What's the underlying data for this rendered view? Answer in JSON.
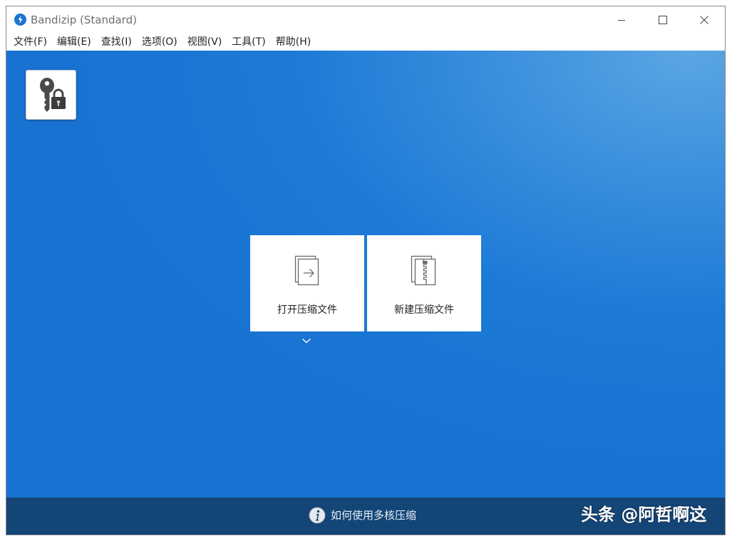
{
  "window": {
    "title": "Bandizip (Standard)"
  },
  "menu": [
    {
      "label": "文件(F)"
    },
    {
      "label": "编辑(E)"
    },
    {
      "label": "查找(I)"
    },
    {
      "label": "选项(O)"
    },
    {
      "label": "视图(V)"
    },
    {
      "label": "工具(T)"
    },
    {
      "label": "帮助(H)"
    }
  ],
  "main": {
    "shortcut_icon": "key-lock-icon",
    "actions": [
      {
        "label": "打开压缩文件",
        "icon": "open-archive-icon"
      },
      {
        "label": "新建压缩文件",
        "icon": "new-archive-icon"
      }
    ],
    "dropdown_icon": "chevron-down-icon"
  },
  "statusbar": {
    "tip": "如何使用多核压缩",
    "tip_icon": "info-icon",
    "watermark": "头条 @阿哲啊这"
  },
  "colors": {
    "accent_blue": "#1c7ad6",
    "statusbar": "#134577",
    "logo_blue": "#1b75d0"
  }
}
